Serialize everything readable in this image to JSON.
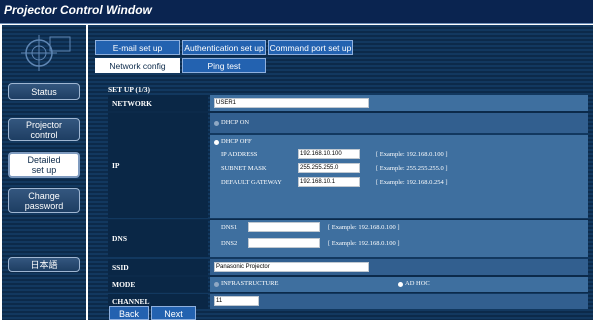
{
  "window": {
    "title": "Projector Control Window"
  },
  "sidebar": {
    "items": [
      {
        "label": "Status"
      },
      {
        "label": "Projector control"
      },
      {
        "label": "Detailed set up"
      },
      {
        "label": "Change password"
      },
      {
        "label": "日本語"
      }
    ]
  },
  "tabs": {
    "row1": [
      "E-mail set up",
      "Authentication set up",
      "Command port set up"
    ],
    "row2": [
      "Network config",
      "Ping test"
    ]
  },
  "setup": {
    "title": "SET UP (1/3)"
  },
  "network": {
    "label": "NETWORK",
    "value": "USER1"
  },
  "ip": {
    "label": "IP",
    "dhcp_on": "DHCP ON",
    "dhcp_off": "DHCP OFF",
    "address_label": "IP ADDRESS",
    "address_value": "192.168.10.100",
    "address_example": "[ Example: 192.168.0.100 ]",
    "subnet_label": "SUBNET MASK",
    "subnet_value": "255.255.255.0",
    "subnet_example": "[ Example: 255.255.255.0 ]",
    "gateway_label": "DEFAULT GATEWAY",
    "gateway_value": "192.168.10.1",
    "gateway_example": "[ Example: 192.168.0.254 ]"
  },
  "dns": {
    "label": "DNS",
    "dns1_label": "DNS1",
    "dns1_value": "",
    "dns1_example": "[ Example: 192.168.0.100 ]",
    "dns2_label": "DNS2",
    "dns2_value": "",
    "dns2_example": "[ Example: 192.168.0.100 ]"
  },
  "ssid": {
    "label": "SSID",
    "value": "Panasonic Projector"
  },
  "mode": {
    "label": "MODE",
    "infrastructure": "INFRASTRUCTURE",
    "adhoc": "AD HOC"
  },
  "channel": {
    "label": "CHANNEL",
    "value": "11"
  },
  "buttons": {
    "back": "Back",
    "next": "Next"
  }
}
